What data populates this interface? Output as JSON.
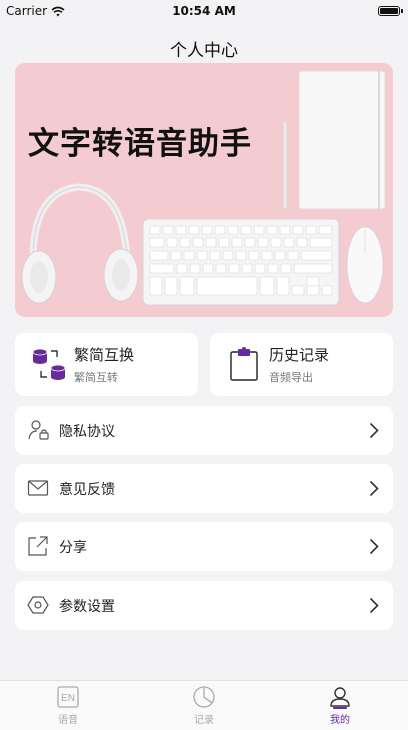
{
  "status": {
    "carrier": "Carrier",
    "time": "10:54 AM"
  },
  "header": {
    "title": "个人中心"
  },
  "banner": {
    "title": "文字转语音助手"
  },
  "quick": [
    {
      "title": "繁简互换",
      "subtitle": "繁简互转",
      "icon": "convert-database-icon"
    },
    {
      "title": "历史记录",
      "subtitle": "音频导出",
      "icon": "clipboard-icon"
    }
  ],
  "menu": [
    {
      "label": "隐私协议",
      "icon": "user-lock-icon"
    },
    {
      "label": "意见反馈",
      "icon": "mail-icon"
    },
    {
      "label": "分享",
      "icon": "share-icon"
    },
    {
      "label": "参数设置",
      "icon": "settings-icon"
    }
  ],
  "tabs": [
    {
      "label": "语音",
      "icon": "en-icon"
    },
    {
      "label": "记录",
      "icon": "pie-chart-icon"
    },
    {
      "label": "我的",
      "icon": "profile-icon",
      "active": true
    }
  ],
  "colors": {
    "accent": "#6a2a9d",
    "banner_bg": "#f3cbd1",
    "page_bg": "#f3f3f5"
  }
}
